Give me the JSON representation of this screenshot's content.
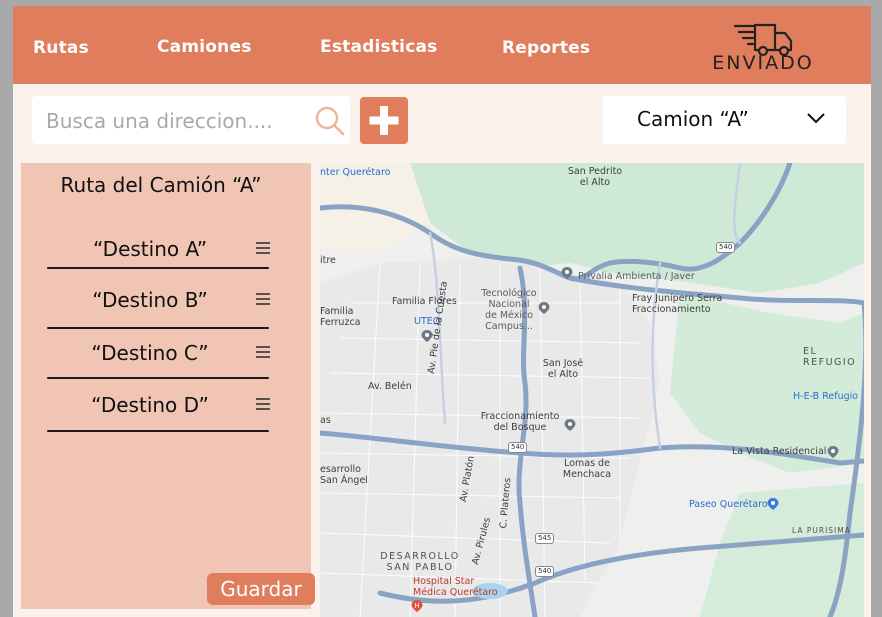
{
  "nav": {
    "links": [
      "Rutas",
      "Camiones",
      "Estadisticas",
      "Reportes"
    ],
    "brand": "ENVIADO"
  },
  "toolbar": {
    "search_placeholder": "Busca una direccion....",
    "truck_selected": "Camion “A”"
  },
  "route_panel": {
    "title": "Ruta del Camión “A”",
    "destinations": [
      "“Destino A”",
      "“Destino B”",
      "“Destino C”",
      "“Destino D”"
    ],
    "save_label": "Guardar"
  },
  "map": {
    "labels": {
      "queretaro": "nter Querétaro",
      "san_pedrito": "San Pedrito\nel Alto",
      "itre": "itre",
      "privalia": "Privalia Ambienta / Javer",
      "fray": "Fray Junípero Serra\nFraccionamiento",
      "familia_ferruzca": "Familia\nFerruzca",
      "familia_flores": "Familia Flores",
      "tec": "Tecnológico\nNacional\nde México\nCampus...",
      "uteq": "UTEQ",
      "refugio": "EL REFUGIO",
      "san_jose": "San José\nel Alto",
      "av_belen": "Av. Belén",
      "av_cuesta": "Av. Pie de la Cuesta",
      "heb": "H-E-B Refugio",
      "fracc_bosque": "Fraccionamiento\ndel Bosque",
      "las": "as",
      "lavista": "La Vista Residencial",
      "desarrollo_angel": "esarrollo\nSan Ángel",
      "lomas": "Lomas de\nMenchaca",
      "av_platon": "Av. Platón",
      "av_plateros": "C. Plateros",
      "av_pirules": "Av. Pirules",
      "paseo": "Paseo Querétaro",
      "purisima": "LA PURISIMA",
      "desarrollo_pablo": "DESARROLLO\nSAN PABLO",
      "hospital": "Hospital Star\nMédica Querétaro",
      "shield_540": "540",
      "shield_545": "545"
    }
  }
}
